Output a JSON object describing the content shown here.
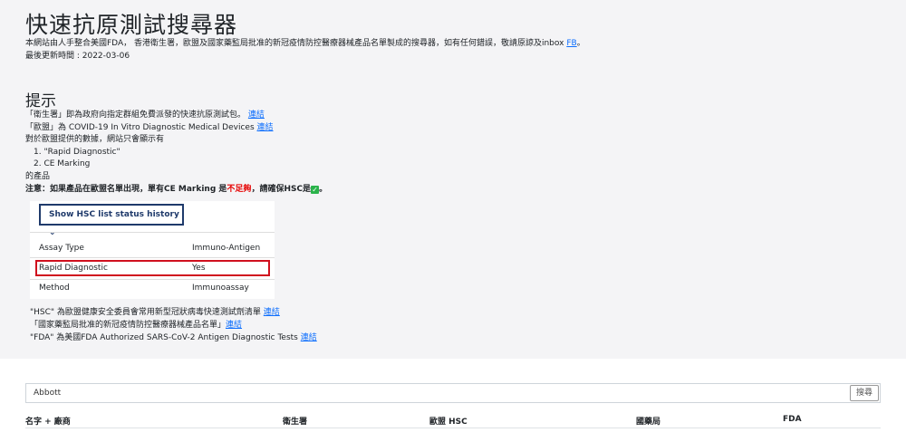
{
  "header": {
    "title": "快速抗原測試搜尋器",
    "description": "本網站由人手整合美國FDA， 香港衛生署，歐盟及國家藥監局批准的新冠疫情防控醫療器械產品名單製成的搜尋器，如有任何錯誤，敬請原諒及inbox",
    "fb_link": "FB",
    "description_end": "。",
    "updated": "最後更新時間 : 2022-03-06"
  },
  "tips": {
    "heading": "提示",
    "line1": "「衛生署」即為政府向指定群組免費派發的快速抗原測試包。",
    "line2": "「歐盟」為 COVID-19 In Vitro Diagnostic Medical Devices",
    "line3": " 對於歐盟提供的數據，網站只會顯示有",
    "item1": "1. \"Rapid Diagnostic\"",
    "item2": "2. CE Marking",
    "line4": "的產品",
    "note_a": "注意：如果產品在歐盟名單出現，單有CE Marking 是",
    "note_red": "不足夠",
    "note_b": "，請確保HSC是",
    "note_c": "。",
    "link_label": "連結"
  },
  "demo": {
    "button": "Show HSC list status history",
    "rows": [
      {
        "k": "Assay Type",
        "v": "Immuno-Antigen"
      },
      {
        "k": "Rapid Diagnostic",
        "v": "Yes"
      },
      {
        "k": "Method",
        "v": "Immunoassay"
      }
    ]
  },
  "links2": {
    "hsc": "\"HSC\" 為歐盟健康安全委員會常用新型冠狀病毒快速測試劑清單",
    "nmpa": "「國家藥監局批准的新冠疫情防控醫療器械產品名單」",
    "fda": "\"FDA\" 為美國FDA Authorized SARS-CoV-2 Antigen Diagnostic Tests",
    "link_label": "連結"
  },
  "search": {
    "value": "Abbott",
    "button": "搜尋"
  },
  "table": {
    "headers": [
      "名字 + 廠商",
      "衛生署",
      "歐盟 HSC",
      "國藥局",
      "FDA"
    ]
  }
}
